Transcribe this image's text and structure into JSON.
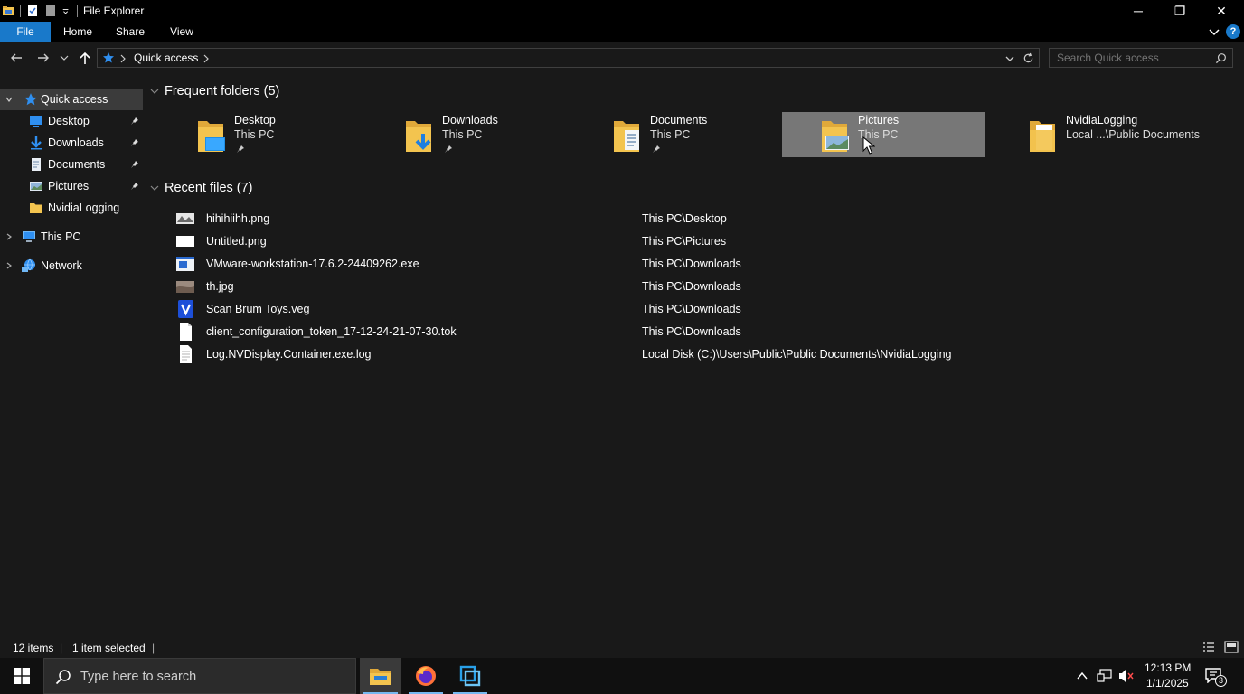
{
  "window": {
    "title": "File Explorer",
    "controls": {
      "minimize": "─",
      "maximize": "❐",
      "close": "✕"
    }
  },
  "ribbon": {
    "tabs": [
      "File",
      "Home",
      "Share",
      "View"
    ],
    "help": "?"
  },
  "address": {
    "path": "Quick access",
    "search_placeholder": "Search Quick access"
  },
  "nav_pane": {
    "quick_access": "Quick access",
    "items": [
      {
        "label": "Desktop",
        "pinned": true
      },
      {
        "label": "Downloads",
        "pinned": true
      },
      {
        "label": "Documents",
        "pinned": true
      },
      {
        "label": "Pictures",
        "pinned": true
      },
      {
        "label": "NvidiaLogging",
        "pinned": false
      }
    ],
    "this_pc": "This PC",
    "network": "Network"
  },
  "main": {
    "frequent_header": "Frequent folders (5)",
    "frequent": [
      {
        "name": "Desktop",
        "location": "This PC",
        "pinned": true
      },
      {
        "name": "Downloads",
        "location": "This PC",
        "pinned": true
      },
      {
        "name": "Documents",
        "location": "This PC",
        "pinned": true
      },
      {
        "name": "Pictures",
        "location": "This PC",
        "pinned": true,
        "selected": true
      },
      {
        "name": "NvidiaLogging",
        "location": "Local ...\\Public Documents",
        "pinned": false
      }
    ],
    "recent_header": "Recent files (7)",
    "recent": [
      {
        "name": "hihihiihh.png",
        "location": "This PC\\Desktop",
        "icon": "image-icon"
      },
      {
        "name": "Untitled.png",
        "location": "This PC\\Pictures",
        "icon": "blank-image-icon"
      },
      {
        "name": "VMware-workstation-17.6.2-24409262.exe",
        "location": "This PC\\Downloads",
        "icon": "exe-icon"
      },
      {
        "name": "th.jpg",
        "location": "This PC\\Downloads",
        "icon": "photo-icon"
      },
      {
        "name": "Scan Brum Toys.veg",
        "location": "This PC\\Downloads",
        "icon": "vegas-icon"
      },
      {
        "name": "client_configuration_token_17-12-24-21-07-30.tok",
        "location": "This PC\\Downloads",
        "icon": "file-icon"
      },
      {
        "name": "Log.NVDisplay.Container.exe.log",
        "location": "Local Disk (C:)\\Users\\Public\\Public Documents\\NvidiaLogging",
        "icon": "text-file-icon"
      }
    ]
  },
  "status": {
    "items": "12 items",
    "selected": "1 item selected"
  },
  "taskbar": {
    "search_placeholder": "Type here to search",
    "time": "12:13 PM",
    "date": "1/1/2025",
    "notification_count": "3"
  },
  "colors": {
    "accent": "#1979ca",
    "background": "#191919",
    "selection": "#777777",
    "nav_selected": "#3b3b3b",
    "folder": "#f3c44f"
  }
}
